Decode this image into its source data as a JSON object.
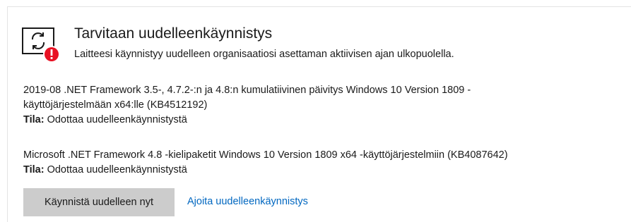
{
  "header": {
    "title": "Tarvitaan uudelleenkäynnistys",
    "subtitle": "Laitteesi käynnistyy uudelleen organisaatiosi asettaman aktiivisen ajan ulkopuolella.",
    "icon": "restart-required-icon",
    "badge_icon": "error-badge-icon",
    "badge_color": "#e81123"
  },
  "updates": [
    {
      "name_line1": "2019-08 .NET Framework 3.5-, 4.7.2-:n ja 4.8:n kumulatiivinen päivitys Windows 10 Version 1809 -",
      "name_line2": "käyttöjärjestelmään x64:lle (KB4512192)",
      "status_label": "Tila:",
      "status_value": " Odottaa uudelleenkäynnistystä"
    },
    {
      "name_line1": "Microsoft .NET Framework 4.8 -kielipaketit Windows 10 Version 1809 x64 -käyttöjärjestelmiin (KB4087642)",
      "status_label": "Tila:",
      "status_value": " Odottaa uudelleenkäynnistystä"
    }
  ],
  "actions": {
    "restart_now": "Käynnistä uudelleen nyt",
    "schedule_restart": "Ajoita uudelleenkäynnistys"
  },
  "colors": {
    "link": "#0067c0",
    "button_bg": "#cccccc"
  }
}
